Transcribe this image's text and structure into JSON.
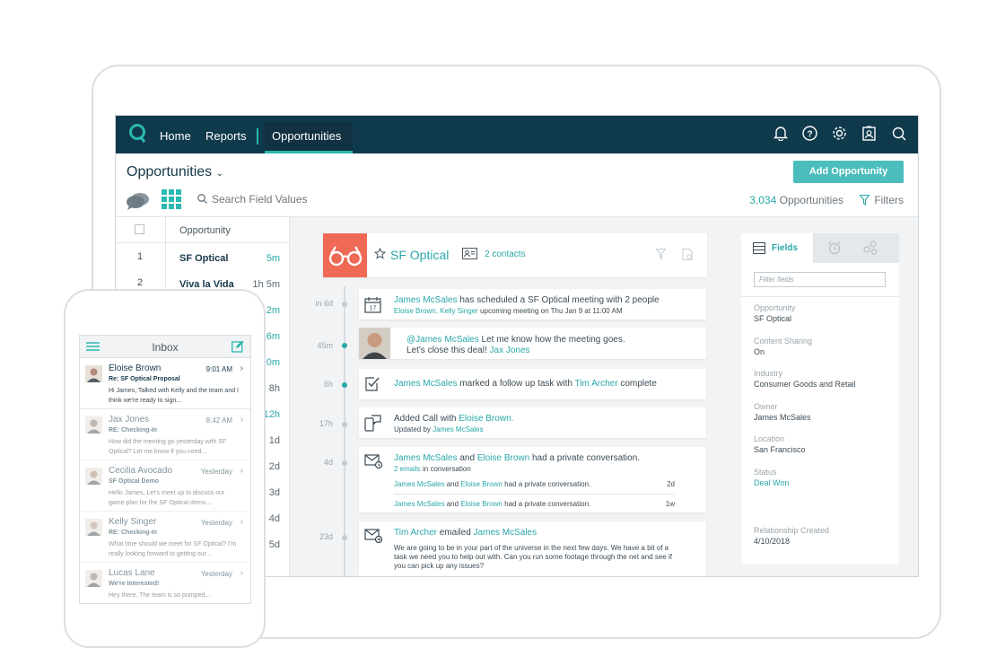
{
  "nav": {
    "links": [
      "Home",
      "Reports"
    ],
    "active": "Opportunities"
  },
  "header": {
    "title": "Opportunities",
    "add_button": "Add Opportunity",
    "search_placeholder": "Search Field Values",
    "count_number": "3,034",
    "count_label": "Opportunities",
    "filters_label": "Filters"
  },
  "list": {
    "column": "Opportunity",
    "rows": [
      {
        "idx": "1",
        "name": "SF Optical",
        "age": "5m",
        "teal": true
      },
      {
        "idx": "2",
        "name": "Viva la Vida",
        "age": "1h 5m",
        "teal": false
      },
      {
        "age": "2m",
        "teal": true
      },
      {
        "age": "6m",
        "teal": true
      },
      {
        "age": "0m",
        "teal": true
      },
      {
        "age": "8h",
        "teal": false
      },
      {
        "age": "12h",
        "teal": true
      },
      {
        "age": "1d",
        "teal": false
      },
      {
        "age": "2d",
        "teal": false
      },
      {
        "age": "3d",
        "teal": false
      },
      {
        "age": "4d",
        "teal": false
      },
      {
        "age": "5d",
        "teal": false
      }
    ]
  },
  "card": {
    "name": "SF Optical",
    "contacts": "2 contacts"
  },
  "timeline": {
    "labels": [
      "in 6d",
      "45m",
      "6h",
      "17h",
      "4d",
      "23d"
    ],
    "e1": {
      "who": "James McSales",
      "text": " has scheduled a SF Optical meeting with 2 people",
      "people": "Eloise Brown, Kelly Singer",
      "sub": " upcoming meeting on Thu Jan 9 at 11:00 AM"
    },
    "e2": {
      "mention": "@James McSales",
      "text": " Let me know how the meeting goes.",
      "line2": "Let's close this deal! ",
      "who2": "Jax Jones"
    },
    "e3": {
      "who": "James McSales",
      "text": " marked a follow up task with ",
      "who2": "Tim Archer",
      "end": " complete"
    },
    "e4": {
      "text": "Added Call with ",
      "who": "Eloise Brown.",
      "sub": "Updated by ",
      "sub_who": "James McSales"
    },
    "e5": {
      "who": "James McSales",
      "and": " and ",
      "who2": "Eloise Brown",
      "text": " had a private conversation.",
      "emails": "2 emails",
      "in_conv": " in conversation",
      "rows": [
        {
          "a": "James McSales",
          "and": " and ",
          "b": "Eloise Brown",
          "text": " had a private conversation.",
          "age": "2d"
        },
        {
          "a": "James McSales",
          "and": " and ",
          "b": "Eloise Brown",
          "text": " had a private conversation.",
          "age": "1w"
        }
      ]
    },
    "e6": {
      "who": "Tim Archer",
      "text": " emailed ",
      "who2": "James McSales",
      "body": "We are going to be in your part of the universe in the next few days. We have a bit of a task we need you to help out with. Can you run some footage through the net and see if you can pick up any issues?"
    }
  },
  "panel": {
    "tab": "Fields",
    "filter_placeholder": "Filter fields",
    "fields": [
      {
        "label": "Opportunity",
        "value": "SF Optical",
        "teal": false
      },
      {
        "label": "Content Sharing",
        "value": "On",
        "teal": false
      },
      {
        "label": "Industry",
        "value": "Consumer Goods and Retail",
        "teal": false
      },
      {
        "label": "Owner",
        "value": "James McSales",
        "teal": false
      },
      {
        "label": "Location",
        "value": "San Francisco",
        "teal": false
      },
      {
        "label": "Status",
        "value": "Deal Won",
        "teal": true
      },
      {
        "label": "Relationship Created",
        "value": "4/10/2018",
        "teal": false
      }
    ]
  },
  "phone": {
    "title": "Inbox",
    "messages": [
      {
        "from": "Eloise Brown",
        "time": "9:01 AM",
        "subject": "Re: SF Optical Proposal",
        "body": "Hi James, Talked with Kelly and the team and I think we're ready to sign...",
        "read": false
      },
      {
        "from": "Jax Jones",
        "time": "8:42 AM",
        "subject": "RE: Checking-In",
        "body": "How did the meeting go yesterday with SF Optical? Let me know if you need...",
        "read": true
      },
      {
        "from": "Cecilia Avocado",
        "time": "Yesterday",
        "subject": "SF Optical Demo",
        "body": "Hello James, Let's meet up to discuss our game plan for the SF Optical demo...",
        "read": true
      },
      {
        "from": "Kelly Singer",
        "time": "Yesterday",
        "subject": "RE: Checking-In",
        "body": "What time should we meet for SF Optical? I'm really looking forward to getting our...",
        "read": true
      },
      {
        "from": "Lucas Lane",
        "time": "Yesterday",
        "subject": "We're Interested!",
        "body": "Hey there, The team is so pumped...",
        "read": true
      }
    ]
  }
}
